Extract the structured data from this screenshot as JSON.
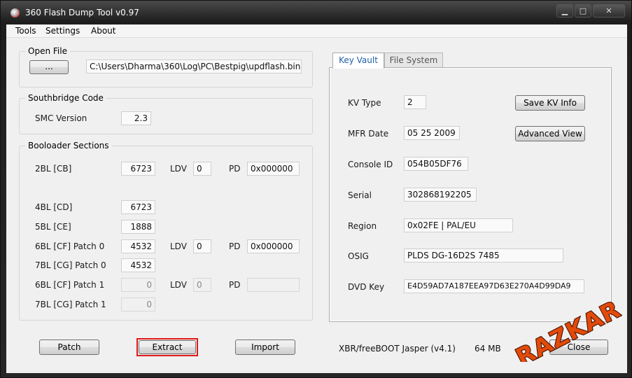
{
  "window": {
    "title": "360 Flash Dump Tool  v0.97",
    "controls": {
      "minimize": "▁",
      "maximize": "□",
      "close": "✕"
    }
  },
  "menu": [
    "Tools",
    "Settings",
    "About"
  ],
  "open_file": {
    "group_title": "Open File",
    "browse_label": "...",
    "path": "C:\\Users\\Dharma\\360\\Log\\PC\\Bestpig\\updflash.bin"
  },
  "southbridge": {
    "group_title": "Southbridge Code",
    "smc_label": "SMC Version",
    "smc_value": "2.3"
  },
  "bootloader": {
    "group_title": "Booloader Sections",
    "ldv_label": "LDV",
    "pd_label": "PD",
    "rows": [
      {
        "label": "2BL [CB]",
        "value": "6723",
        "ldv": "0",
        "pd": "0x000000"
      },
      {
        "label": "4BL [CD]",
        "value": "6723"
      },
      {
        "label": "5BL [CE]",
        "value": "1888"
      },
      {
        "label": "6BL [CF] Patch 0",
        "value": "4532",
        "ldv": "0",
        "pd": "0x000000"
      },
      {
        "label": "7BL [CG] Patch 0",
        "value": "4532"
      },
      {
        "label": "6BL [CF] Patch 1",
        "value": "0",
        "ldv": "0",
        "pd": ""
      },
      {
        "label": "7BL [CG] Patch 1",
        "value": "0"
      }
    ]
  },
  "actions": {
    "patch": "Patch",
    "extract": "Extract",
    "import": "Import",
    "close": "Close"
  },
  "tabs": [
    {
      "label": "Key Vault",
      "active": true
    },
    {
      "label": "File System",
      "active": false
    }
  ],
  "key_vault": {
    "kv_type": {
      "label": "KV Type",
      "value": "2"
    },
    "mfr_date": {
      "label": "MFR Date",
      "value": "05 25 2009"
    },
    "console_id": {
      "label": "Console ID",
      "value": "054B05DF76"
    },
    "serial": {
      "label": "Serial",
      "value": "302868192205"
    },
    "region": {
      "label": "Region",
      "value": "0x02FE   |   PAL/EU"
    },
    "osig": {
      "label": "OSIG",
      "value": "PLDS    DG-16D2S       7485"
    },
    "dvd_key": {
      "label": "DVD Key",
      "value": "E4D59AD7A187EEA97D63E270A4D99DA9"
    },
    "save_kv_label": "Save KV Info",
    "advanced_view_label": "Advanced View"
  },
  "status": {
    "firmware": "XBR/freeBOOT Jasper (v4.1)",
    "size": "64 MB"
  },
  "colors": {
    "highlight": "#e01b1b",
    "tab_active_text": "#1f5fa8",
    "watermark": "#e24a0a"
  }
}
